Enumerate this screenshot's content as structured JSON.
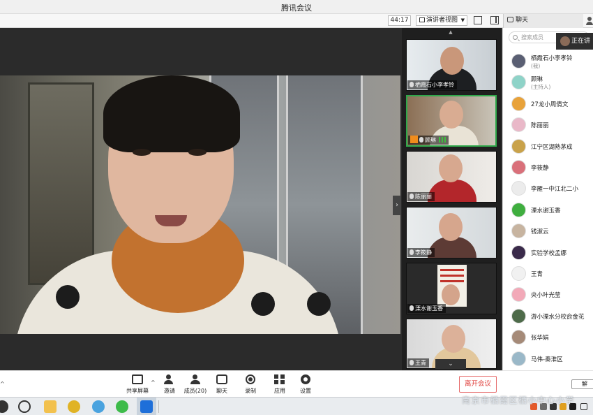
{
  "window": {
    "title": "腾讯会议"
  },
  "toolbar": {
    "timer": "44:17",
    "view_mode": "演讲者视图",
    "chat_tab": "聊天"
  },
  "speaking_indicator": "正在讲",
  "thumbnails": [
    {
      "name": "栖霞石小李孝铃",
      "active": false,
      "host": false
    },
    {
      "name": "顾琳",
      "active": true,
      "host": true
    },
    {
      "name": "陈丽丽",
      "active": false,
      "host": false
    },
    {
      "name": "李筱静",
      "active": false,
      "host": false
    },
    {
      "name": "溧水谢玉香",
      "active": false,
      "host": false
    },
    {
      "name": "王青",
      "active": false,
      "host": false
    }
  ],
  "panel": {
    "search_placeholder": "搜索成员",
    "participants": [
      {
        "name": "栖霞石小李孝铃",
        "role": "(我)",
        "color": "#5a5f73"
      },
      {
        "name": "顾琳",
        "role": "(主持人)",
        "color": "#8fd3c8"
      },
      {
        "name": "27龙小周倩文",
        "role": "",
        "color": "#e8a23a"
      },
      {
        "name": "陈丽丽",
        "role": "",
        "color": "#e9b8c8"
      },
      {
        "name": "江宁区湖熟茅成",
        "role": "",
        "color": "#c9a24a"
      },
      {
        "name": "李筱静",
        "role": "",
        "color": "#d9707a"
      },
      {
        "name": "李雁一中江北二小",
        "role": "",
        "color": "#ececec"
      },
      {
        "name": "溧水谢玉香",
        "role": "",
        "color": "#3fae3f"
      },
      {
        "name": "钱淑云",
        "role": "",
        "color": "#c7b4a0"
      },
      {
        "name": "实验学校孟娜",
        "role": "",
        "color": "#3a2a4a"
      },
      {
        "name": "王青",
        "role": "",
        "color": "#f1f1f1"
      },
      {
        "name": "央小叶光莹",
        "role": "",
        "color": "#f2a9b8"
      },
      {
        "name": "游小溧水分校俞金花",
        "role": "",
        "color": "#4e6b4a"
      },
      {
        "name": "张华娟",
        "role": "",
        "color": "#a58a78"
      },
      {
        "name": "马伟-秦淮区",
        "role": "",
        "color": "#9ab8c8"
      }
    ]
  },
  "controls": {
    "share": "共享屏幕",
    "invite": "邀请",
    "members": "成员(20)",
    "chat": "聊天",
    "record": "录制",
    "apps": "应用",
    "settings": "设置",
    "leave": "离开会议",
    "right_button": "解"
  },
  "watermark": "南京市栖霞区栖小中心小学",
  "colors": {
    "accent_green": "#2fa84a",
    "leave_red": "#e0413d",
    "host_orange": "#f08c1c"
  }
}
